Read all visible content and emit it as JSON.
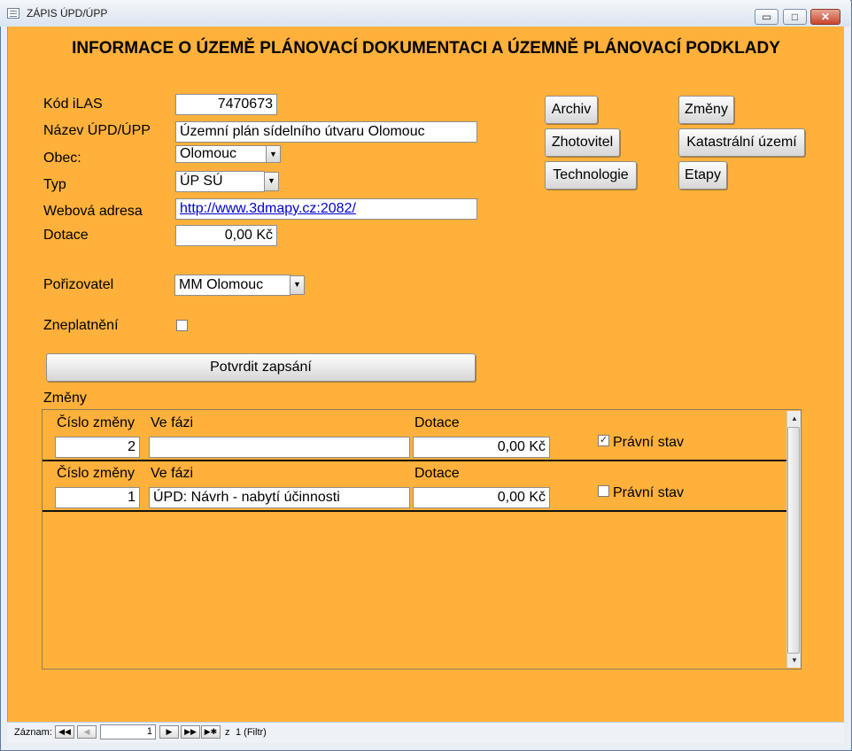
{
  "window": {
    "title": "ZÁPIS ÚPD/ÚPP",
    "minimize": "▭",
    "restore": "□",
    "close": "✕"
  },
  "heading": "INFORMACE O ÚZEMĚ PLÁNOVACÍ DOKUMENTACI A ÚZEMNĚ PLÁNOVACÍ PODKLADY",
  "fields": {
    "kod_label": "Kód iLAS",
    "kod_value": "7470673",
    "nazev_label": "Název ÚPD/ÚPP",
    "nazev_value": "Územní plán sídelního útvaru Olomouc",
    "obec_label": "Obec:",
    "obec_value": "Olomouc",
    "typ_label": "Typ",
    "typ_value": "ÚP SÚ",
    "web_label": "Webová adresa",
    "web_value": "http://www.3dmapy.cz:2082/",
    "dotace_label": "Dotace",
    "dotace_value": "0,00 Kč",
    "porizovatel_label": "Pořizovatel",
    "porizovatel_value": "MM Olomouc",
    "zneplatneni_label": "Zneplatnění"
  },
  "buttons": {
    "archiv": "Archiv",
    "zmeny": "Změny",
    "zhotovitel": "Zhotovitel",
    "katastralni": "Katastrální území",
    "technologie": "Technologie",
    "etapy": "Etapy",
    "potvrdit": "Potvrdit zapsání"
  },
  "subform": {
    "title": "Změny",
    "headers": {
      "cislo": "Číslo změny",
      "faze": "Ve fázi",
      "dotace": "Dotace"
    },
    "rows": [
      {
        "cislo": "2",
        "faze": "",
        "dotace": "0,00 Kč",
        "pravni_label": "Právní stav",
        "pravni_checked": "✓"
      },
      {
        "cislo": "1",
        "faze": "ÚPD: Návrh - nabytí účinnosti",
        "dotace": "0,00 Kč",
        "pravni_label": "Právní stav",
        "pravni_checked": ""
      }
    ]
  },
  "status": {
    "zaznam_label": "Záznam:",
    "record_value": "1",
    "of_label": "z",
    "total": "1 (Filtr)",
    "first": "◀◀",
    "prev": "◀",
    "next": "▶",
    "last": "▶▶",
    "new": "▶✱"
  },
  "colors": {
    "form_bg": "#ffb13b",
    "hyperlink": "#0000d0"
  }
}
